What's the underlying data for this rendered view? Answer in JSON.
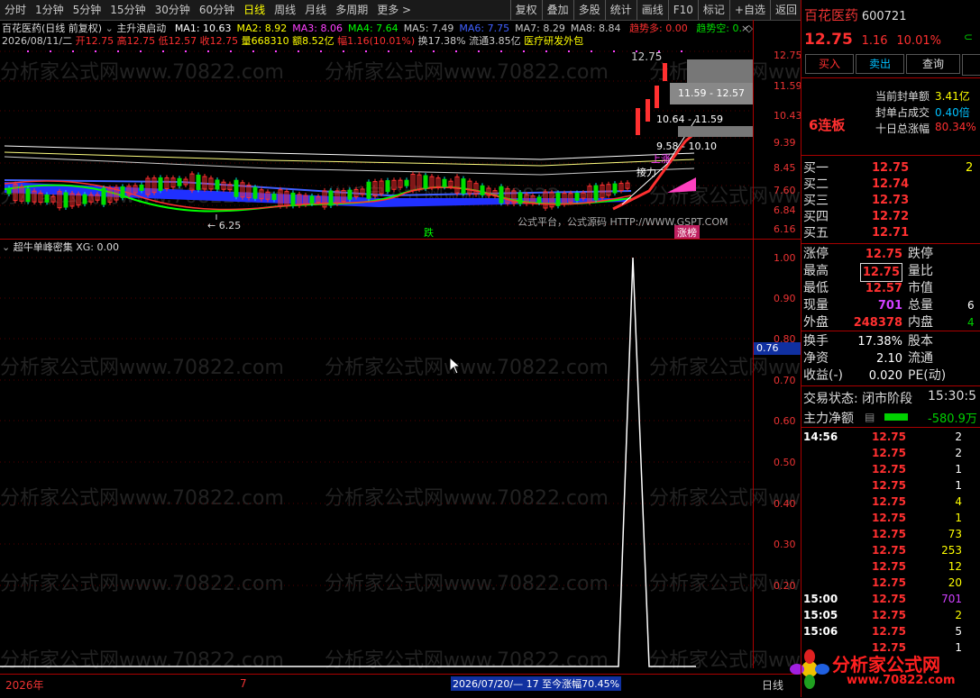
{
  "toolbar": {
    "periods": [
      "分时",
      "1分钟",
      "5分钟",
      "15分钟",
      "30分钟",
      "60分钟",
      "日线",
      "周线",
      "月线",
      "多周期",
      "更多 >"
    ],
    "active_period": "日线",
    "actions": [
      "复权",
      "叠加",
      "多股",
      "统计",
      "画线",
      "F10",
      "标记",
      "+自选",
      "返回"
    ]
  },
  "chart_header": {
    "title": "百花医药(日线 前复权)",
    "formula": "主升浪启动",
    "ma": [
      {
        "label": "MA1: 10.63",
        "color": "#ffffff"
      },
      {
        "label": "MA2: 8.92",
        "color": "#ffff00"
      },
      {
        "label": "MA3: 8.06",
        "color": "#ff40ff"
      },
      {
        "label": "MA4: 7.64",
        "color": "#00ff00"
      },
      {
        "label": "MA5: 7.49",
        "color": "#c8c8c8"
      },
      {
        "label": "MA6: 7.75",
        "color": "#4060ff"
      },
      {
        "label": "MA7: 8.29",
        "color": "#c8c8c8"
      },
      {
        "label": "MA8: 8.84",
        "color": "#c8c8c8"
      }
    ],
    "trend_up": "趋势多: 0.00",
    "trend_down": "趋势空: 0.",
    "info_date": "2026/08/11/二",
    "open": "开12.75",
    "high": "高12.75",
    "low": "低12.57",
    "close": "收12.75",
    "volume": "量668310",
    "amount": "额8.52亿",
    "change": "幅1.16(10.01%)",
    "turnover": "换17.38%",
    "float": "流通3.85亿",
    "sector": "医疗研发外包"
  },
  "main_axis": [
    "12.75",
    "11.59",
    "10.43",
    "9.39",
    "8.45",
    "7.60",
    "6.84",
    "6.16"
  ],
  "annotations": {
    "top_price": "12.75",
    "zone1": "11.59 - 12.57",
    "zone2": "10.64 - 11.59",
    "zone3": "9.58 - 10.10",
    "low_label": "← 6.25",
    "jieli": "接力",
    "shangzhang": "上涨",
    "die": "跌",
    "zhangting": "涨榜",
    "platform": "公式平台，公式源码 HTTP://WWW.GSPT.COM"
  },
  "indicator": {
    "title": "超牛单峰密集",
    "value": "XG: 0.00",
    "axis": [
      "1.00",
      "0.90",
      "0.80",
      "0.70",
      "0.60",
      "0.50",
      "0.40",
      "0.30",
      "0.20"
    ],
    "marker": "0.76"
  },
  "bottom": {
    "year": "2026年",
    "month": "7",
    "range": "2026/07/20/— 17 至今涨幅70.45%",
    "period": "日线"
  },
  "watermark": "分析家公式网www.70822.com",
  "right": {
    "name": "百花医药",
    "code": "600721",
    "price": "12.75",
    "change": "1.16",
    "pct": "10.01%",
    "buttons": [
      "买入",
      "卖出",
      "查询"
    ],
    "seal_label1": "当前封单额",
    "seal_val1": "3.41亿",
    "seal_label2": "封单占成交",
    "seal_val2": "0.40倍",
    "seal_label3": "十日总涨幅",
    "seal_val3": "80.34%",
    "streak": "6连板",
    "bids": [
      {
        "label": "买一",
        "price": "12.75",
        "vol": "2"
      },
      {
        "label": "买二",
        "price": "12.74",
        "vol": ""
      },
      {
        "label": "买三",
        "price": "12.73",
        "vol": ""
      },
      {
        "label": "买四",
        "price": "12.72",
        "vol": ""
      },
      {
        "label": "买五",
        "price": "12.71",
        "vol": ""
      }
    ],
    "stats": [
      {
        "l1": "涨停",
        "v1": "12.75",
        "l2": "跌停",
        "c1": "red"
      },
      {
        "l1": "最高",
        "v1": "12.75",
        "l2": "量比",
        "c1": "red"
      },
      {
        "l1": "最低",
        "v1": "12.57",
        "l2": "市值",
        "c1": "red"
      },
      {
        "l1": "现量",
        "v1": "701",
        "l2": "总量",
        "c1": "purple"
      },
      {
        "l1": "外盘",
        "v1": "248378",
        "l2": "内盘",
        "c1": "red"
      }
    ],
    "stats_tail": [
      "",
      "",
      "",
      "6",
      "4"
    ],
    "stats2": [
      {
        "l1": "换手",
        "v1": "17.38%",
        "l2": "股本"
      },
      {
        "l1": "净资",
        "v1": "2.10",
        "l2": "流通"
      },
      {
        "l1": "收益(-)",
        "v1": "0.020",
        "l2": "PE(动)"
      }
    ],
    "trade_state": "交易状态: 闭市阶段",
    "trade_time": "15:30:5",
    "main_net_label": "主力净额",
    "main_net_val": "-580.9万",
    "trades": [
      {
        "t": "14:56",
        "p": "12.75",
        "v": "2",
        "vc": "white"
      },
      {
        "t": "",
        "p": "12.75",
        "v": "2",
        "vc": "white"
      },
      {
        "t": "",
        "p": "12.75",
        "v": "1",
        "vc": "white"
      },
      {
        "t": "",
        "p": "12.75",
        "v": "1",
        "vc": "white"
      },
      {
        "t": "",
        "p": "12.75",
        "v": "4",
        "vc": "yellow"
      },
      {
        "t": "",
        "p": "12.75",
        "v": "1",
        "vc": "yellow"
      },
      {
        "t": "",
        "p": "12.75",
        "v": "73",
        "vc": "yellow"
      },
      {
        "t": "",
        "p": "12.75",
        "v": "253",
        "vc": "yellow"
      },
      {
        "t": "",
        "p": "12.75",
        "v": "12",
        "vc": "yellow"
      },
      {
        "t": "",
        "p": "12.75",
        "v": "20",
        "vc": "yellow"
      },
      {
        "t": "15:00",
        "p": "12.75",
        "v": "701",
        "vc": "purple"
      },
      {
        "t": "15:05",
        "p": "12.75",
        "v": "2",
        "vc": "yellow"
      },
      {
        "t": "15:06",
        "p": "12.75",
        "v": "5",
        "vc": "white"
      },
      {
        "t": "",
        "p": "12.75",
        "v": "1",
        "vc": "white"
      }
    ],
    "logo": "分析家公式网",
    "logo_url": "www.70822.com"
  }
}
